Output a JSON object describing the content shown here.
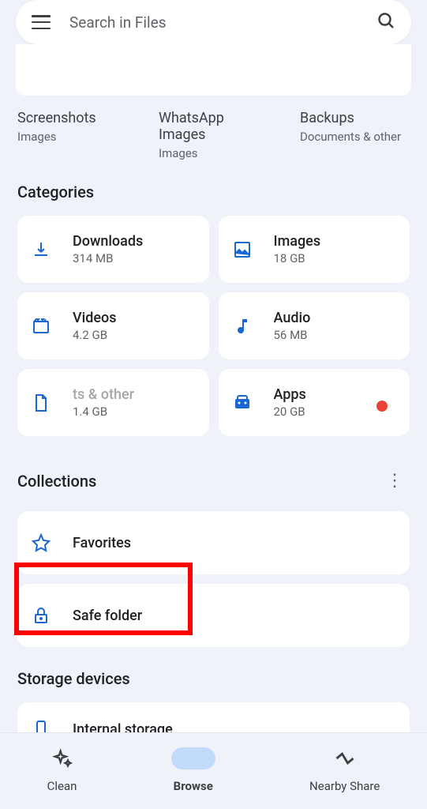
{
  "search": {
    "placeholder": "Search in Files"
  },
  "quickAccess": [
    {
      "title": "Screenshots",
      "subtitle": "Images"
    },
    {
      "title": "WhatsApp Images",
      "subtitle": "Images"
    },
    {
      "title": "Backups",
      "subtitle": "Documents & other"
    }
  ],
  "sections": {
    "categories": "Categories",
    "collections": "Collections",
    "storage": "Storage devices"
  },
  "categories": [
    {
      "name": "Downloads",
      "size": "314 MB"
    },
    {
      "name": "Images",
      "size": "18 GB"
    },
    {
      "name": "Videos",
      "size": "4.2 GB"
    },
    {
      "name": "Audio",
      "size": "56 MB"
    },
    {
      "name": "ts & other",
      "size": "1.4 GB"
    },
    {
      "name": "Apps",
      "size": "20 GB"
    }
  ],
  "collections": [
    {
      "name": "Favorites"
    },
    {
      "name": "Safe folder"
    }
  ],
  "storage": [
    {
      "name": "Internal storage"
    }
  ],
  "nav": [
    {
      "label": "Clean"
    },
    {
      "label": "Browse"
    },
    {
      "label": "Nearby Share"
    }
  ],
  "colors": {
    "accent": "#1a73e8",
    "iconBlue": "#1967d2",
    "red": "#ea4335"
  }
}
